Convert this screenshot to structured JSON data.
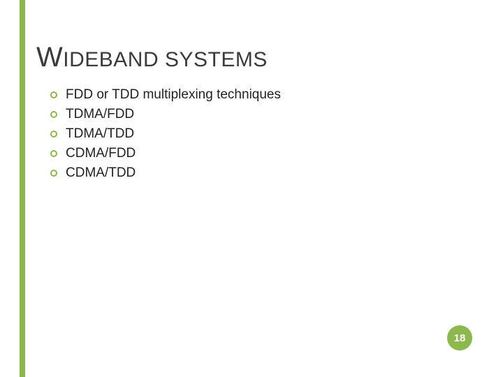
{
  "title": {
    "cap1": "W",
    "word1_rest": "IDEBAND",
    "space": " ",
    "word2": "SYSTEMS"
  },
  "bullets": [
    "FDD or TDD multiplexing techniques",
    "TDMA/FDD",
    "TDMA/TDD",
    "CDMA/FDD",
    "CDMA/TDD"
  ],
  "page_number": "18"
}
